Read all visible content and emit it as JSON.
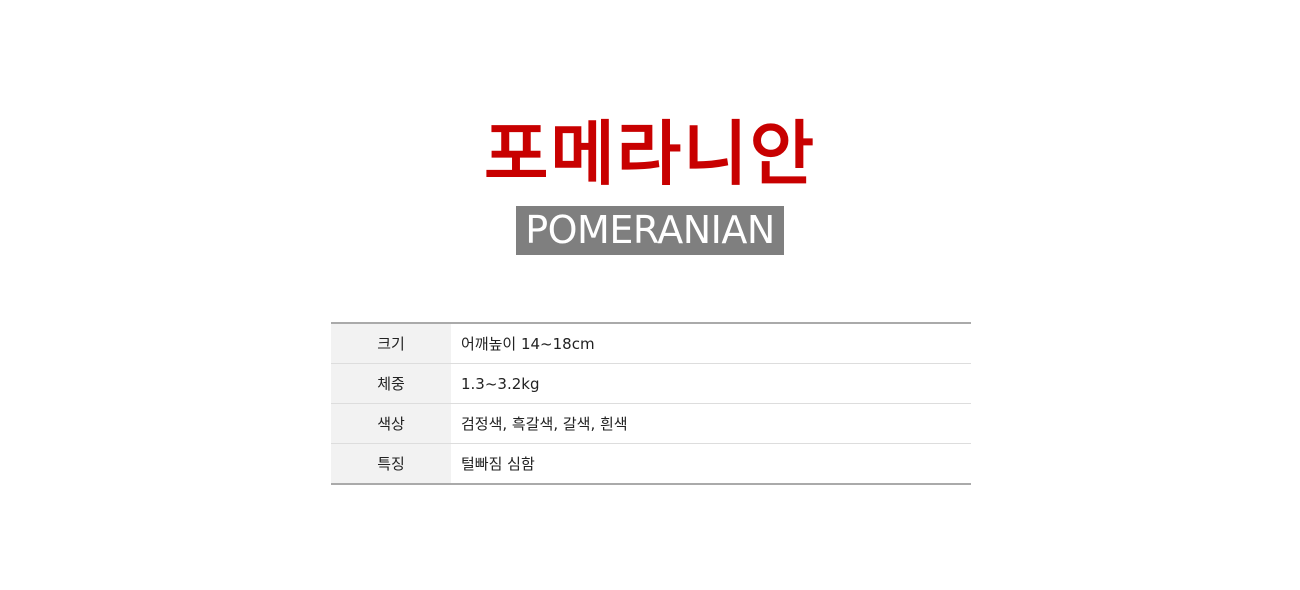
{
  "title_kr": "포메라니안",
  "title_en": "POMERANIAN",
  "specs": [
    {
      "label": "크기",
      "value": "어깨높이 14~18cm"
    },
    {
      "label": "체중",
      "value": "1.3~3.2kg"
    },
    {
      "label": "색상",
      "value": "검정색, 흑갈색, 갈색, 흰색"
    },
    {
      "label": "특징",
      "value": "털빠짐 심함"
    }
  ],
  "colors": {
    "title": "#c80000",
    "badge_bg": "#7f7f7f",
    "label_bg": "#f2f2f2"
  }
}
